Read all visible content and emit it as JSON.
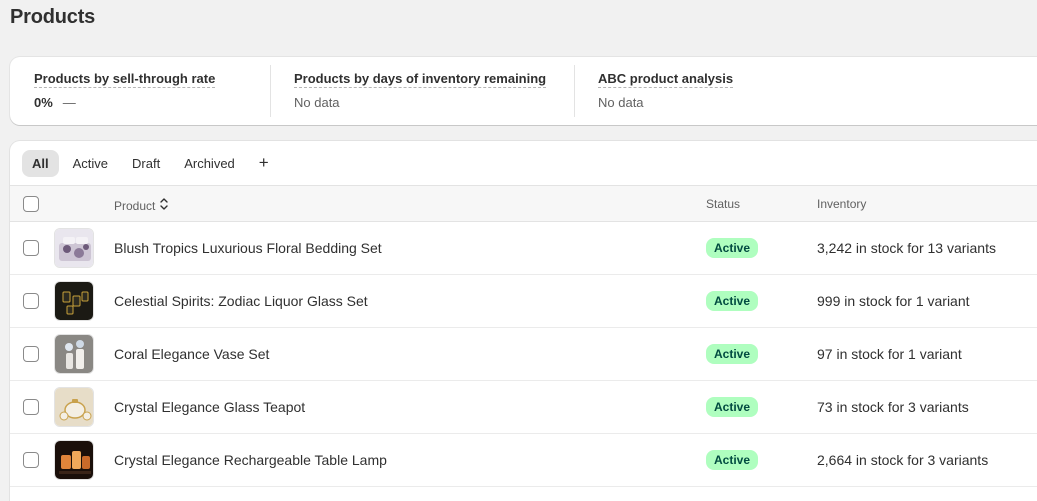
{
  "page": {
    "title": "Products"
  },
  "metrics": [
    {
      "label": "Products by sell-through rate",
      "value": "0%",
      "trend": "—"
    },
    {
      "label": "Products by days of inventory remaining",
      "value": "No data"
    },
    {
      "label": "ABC product analysis",
      "value": "No data"
    }
  ],
  "tabs": [
    {
      "label": "All",
      "selected": true
    },
    {
      "label": "Active",
      "selected": false
    },
    {
      "label": "Draft",
      "selected": false
    },
    {
      "label": "Archived",
      "selected": false
    }
  ],
  "add_tab_icon": "+",
  "table": {
    "columns": {
      "product": "Product",
      "status": "Status",
      "inventory": "Inventory"
    },
    "rows": [
      {
        "name": "Blush Tropics Luxurious Floral Bedding Set",
        "status": "Active",
        "inventory": "3,242 in stock for 13 variants",
        "thumb_icon": "bedding-thumbnail",
        "thumb_colors": [
          "#cdc5d4",
          "#6d5a7a"
        ]
      },
      {
        "name": "Celestial Spirits: Zodiac Liquor Glass Set",
        "status": "Active",
        "inventory": "999 in stock for 1 variant",
        "thumb_icon": "glass-set-thumbnail",
        "thumb_colors": [
          "#1b1a14",
          "#c8a13a"
        ]
      },
      {
        "name": "Coral Elegance Vase Set",
        "status": "Active",
        "inventory": "97 in stock for 1 variant",
        "thumb_icon": "vase-thumbnail",
        "thumb_colors": [
          "#8a8884",
          "#e8e6e2"
        ]
      },
      {
        "name": "Crystal Elegance Glass Teapot",
        "status": "Active",
        "inventory": "73 in stock for 3 variants",
        "thumb_icon": "teapot-thumbnail",
        "thumb_colors": [
          "#e7ddc8",
          "#c9a24e"
        ]
      },
      {
        "name": "Crystal Elegance Rechargeable Table Lamp",
        "status": "Active",
        "inventory": "2,664 in stock for 3 variants",
        "thumb_icon": "lamp-thumbnail",
        "thumb_colors": [
          "#1a0f0a",
          "#e0843a"
        ]
      }
    ]
  },
  "colors": {
    "active_badge_bg": "#affebf",
    "active_badge_text": "#014b40",
    "page_bg": "#f1f1f1"
  }
}
